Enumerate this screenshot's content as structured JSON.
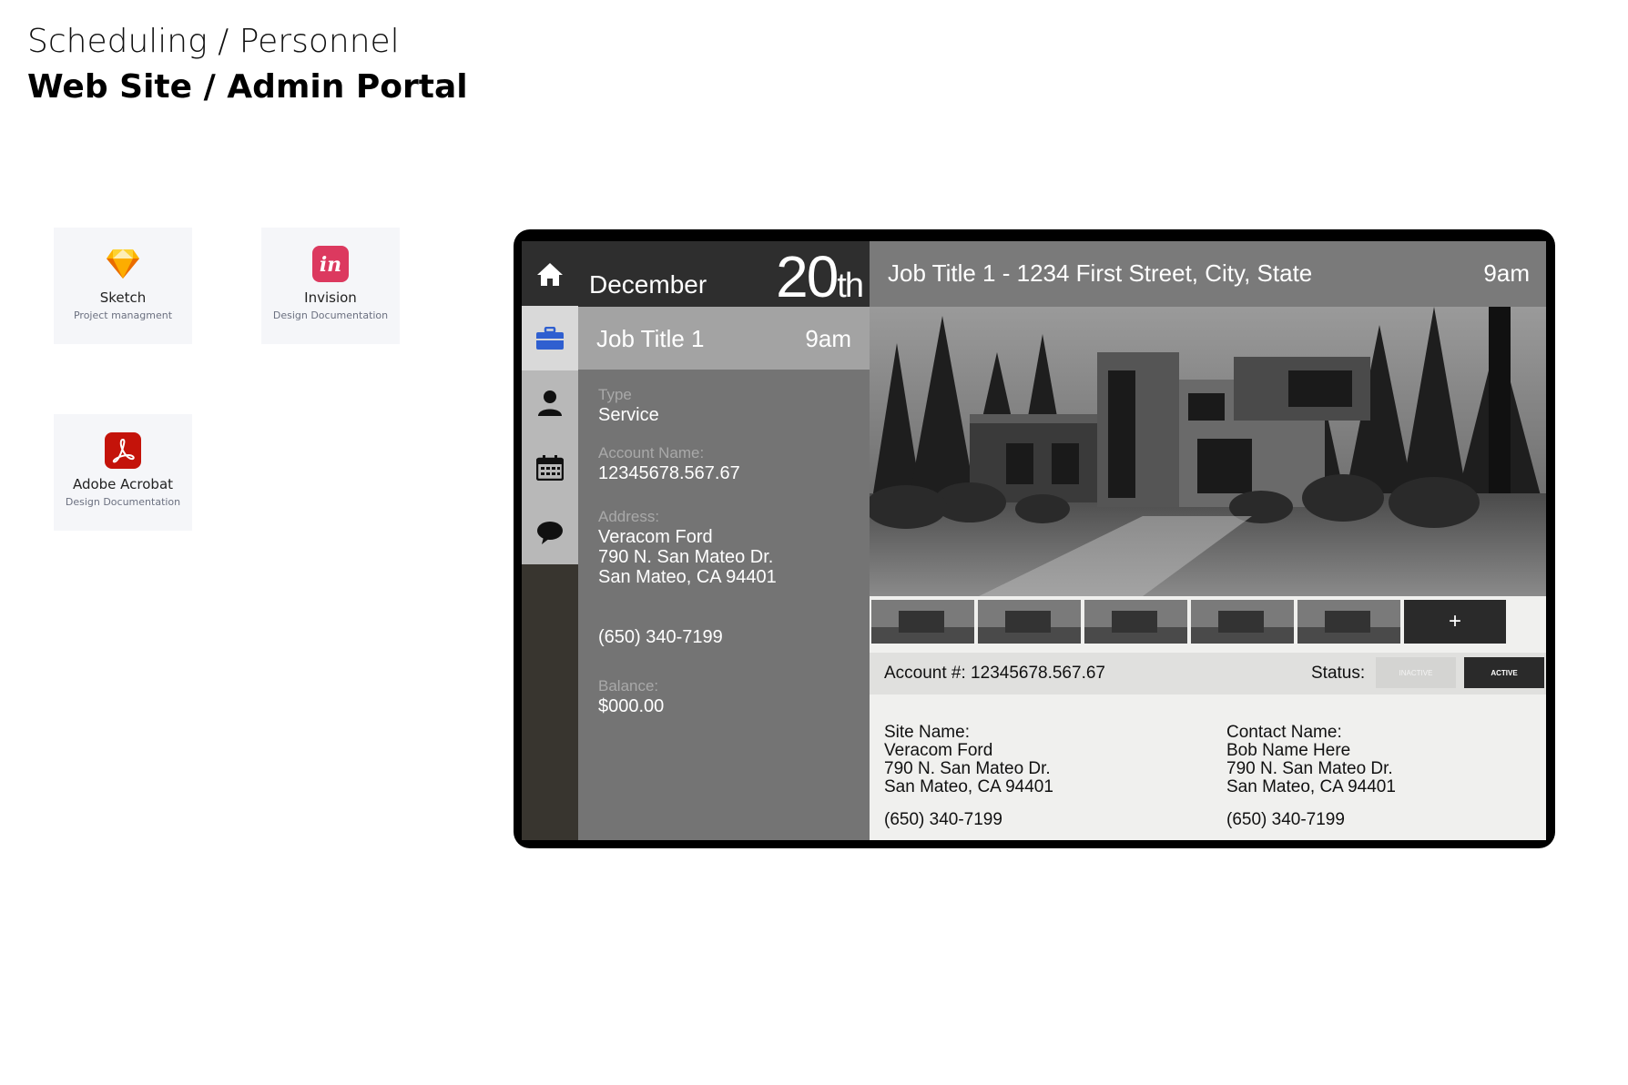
{
  "header": {
    "subtitle": "Scheduling / Personnel",
    "title": "Web Site / Admin Portal"
  },
  "tools": [
    {
      "name": "Sketch",
      "desc": "Project managment",
      "icon": "sketch-icon",
      "color": "#f7a21b"
    },
    {
      "name": "Invision",
      "desc": "Design Documentation",
      "icon": "invision-icon",
      "color": "#dc395f"
    },
    {
      "name": "Adobe Acrobat",
      "desc": "Design Documentation",
      "icon": "acrobat-icon",
      "color": "#c4130a"
    }
  ],
  "app": {
    "rail": [
      {
        "icon": "home-icon"
      },
      {
        "icon": "briefcase-icon",
        "active": true,
        "accent": "#2f5fd0"
      },
      {
        "icon": "person-icon"
      },
      {
        "icon": "calendar-icon"
      },
      {
        "icon": "chat-bubble-icon"
      }
    ],
    "date": {
      "month": "December",
      "day": "20",
      "suffix": "th"
    },
    "job": {
      "title": "Job Title 1",
      "time": "9am"
    },
    "details": {
      "type_label": "Type",
      "type_value": "Service",
      "account_label": "Account Name:",
      "account_value": "12345678.567.67",
      "address_label": "Address:",
      "address_lines": [
        "Veracom Ford",
        "790 N. San Mateo Dr.",
        "San Mateo, CA 94401"
      ],
      "phone": "(650) 340-7199",
      "balance_label": "Balance:",
      "balance_value": "$000.00"
    },
    "titlebar": {
      "title": "Job Title 1  - 1234 First Street, City, State",
      "time": "9am"
    },
    "thumbs_add": "+",
    "account": {
      "label": "Account #:  12345678.567.67",
      "status_label": "Status:",
      "inactive": "INACTIVE",
      "active": "ACTIVE"
    },
    "site": {
      "label": "Site Name:",
      "lines": [
        "Veracom Ford",
        "790 N. San Mateo Dr.",
        "San Mateo, CA 94401"
      ],
      "phone": "(650) 340-7199"
    },
    "contact": {
      "label": "Contact Name:",
      "lines": [
        "Bob Name Here",
        "790 N. San Mateo Dr.",
        "San Mateo, CA 94401"
      ],
      "phone": "(650) 340-7199"
    }
  }
}
